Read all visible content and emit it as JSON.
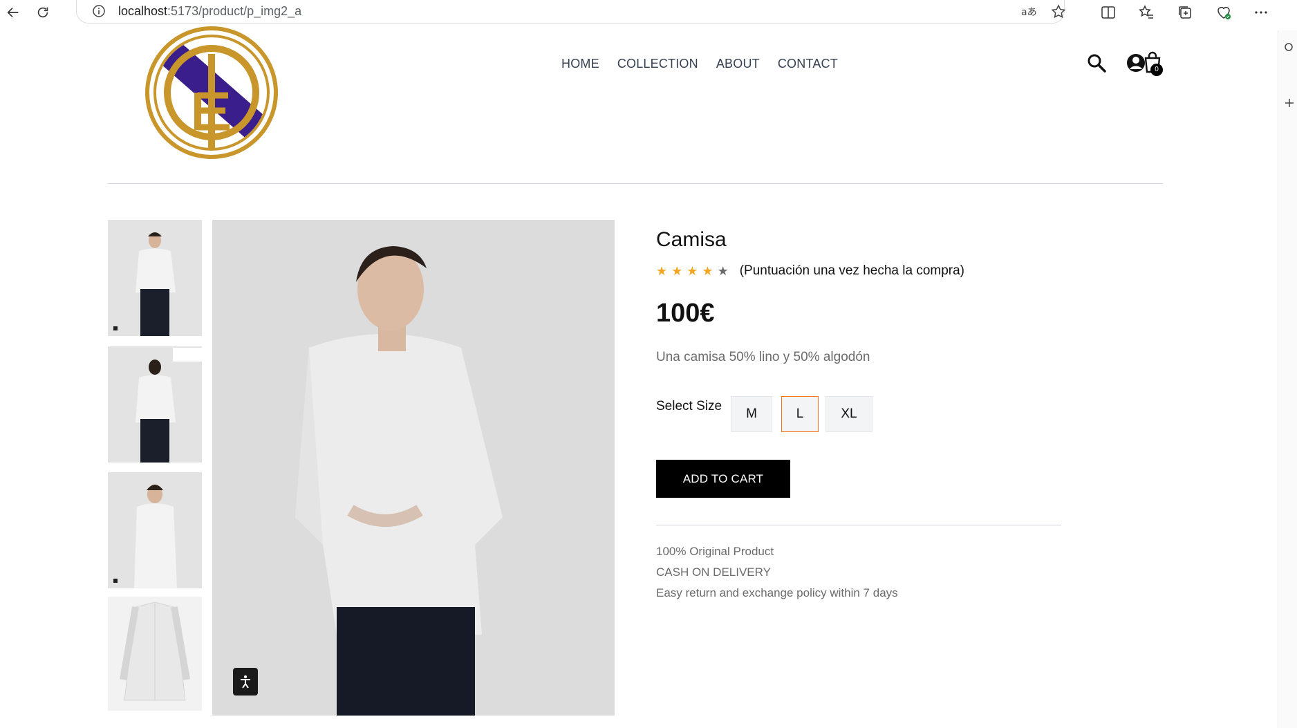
{
  "browser": {
    "url_host": "localhost",
    "url_path": ":5173/product/p_img2_a"
  },
  "nav": {
    "items": [
      "HOME",
      "COLLECTION",
      "ABOUT",
      "CONTACT"
    ]
  },
  "cart": {
    "count": "0"
  },
  "product": {
    "title": "Camisa",
    "rating": 4,
    "rating_max": 5,
    "rating_note": "(Puntuación una vez hecha la compra)",
    "price": "100€",
    "description": "Una camisa 50% lino y 50% algodón",
    "size_label": "Select Size",
    "sizes": [
      "M",
      "L",
      "XL"
    ],
    "selected_size": "L",
    "add_to_cart": "ADD TO CART",
    "info": [
      "100% Original Product",
      "CASH ON DELIVERY",
      "Easy return and exchange policy within 7 days"
    ]
  },
  "colors": {
    "star_filled": "#f5a623",
    "star_empty": "#6b6b6b",
    "logo_gold": "#c9962b",
    "logo_purple": "#3a1f8c",
    "selected_border": "#f97316"
  }
}
